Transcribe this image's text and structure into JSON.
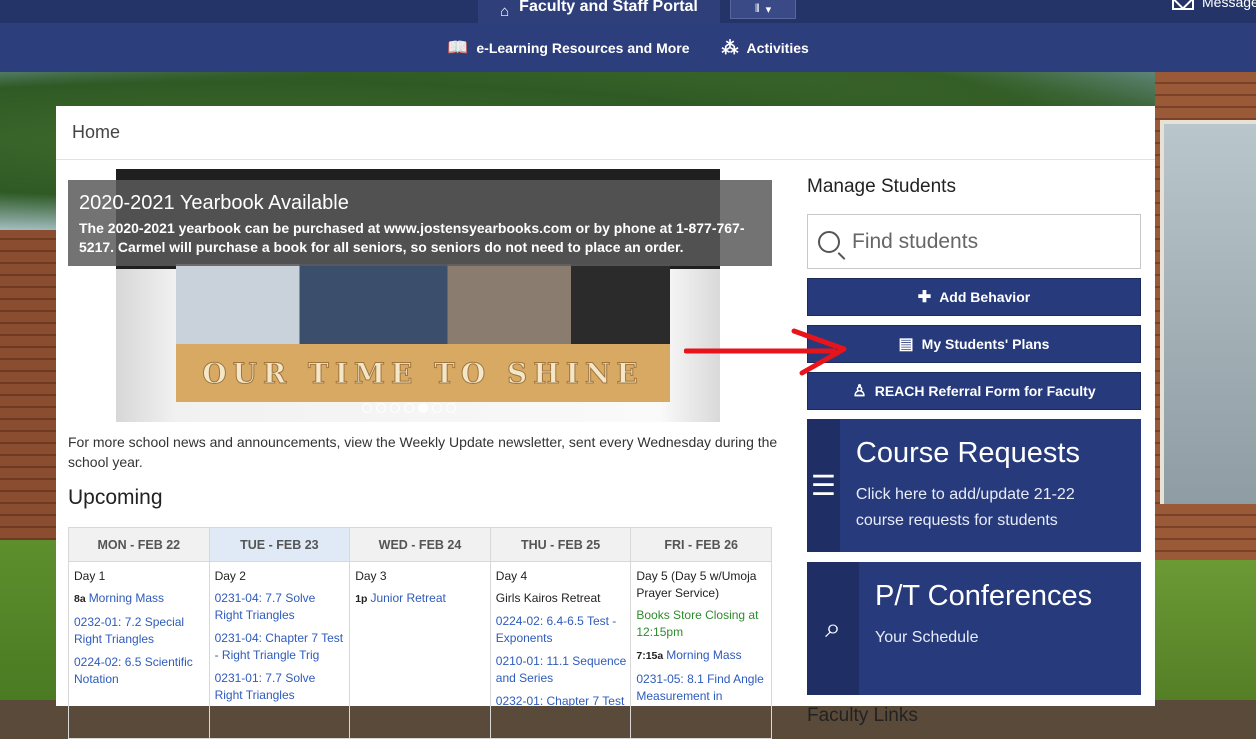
{
  "topbar": {
    "portal_label": "Faculty and Staff Portal",
    "messages_label": "Messages"
  },
  "nav": {
    "items": [
      {
        "label": "e-Learning Resources and More",
        "icon": "book-icon"
      },
      {
        "label": "Activities",
        "icon": "activities-icon"
      }
    ]
  },
  "breadcrumb": "Home",
  "carousel": {
    "title": "2020-2021 Yearbook Available",
    "body": "The 2020-2021 yearbook can be purchased at www.jostensyearbooks.com or by phone at 1-877-767-5217. Carmel will purchase a book for all seniors, so seniors do not need to place an order.",
    "banner_text": "OUR TIME TO SHINE",
    "slide_count": 7,
    "active_slide": 5
  },
  "news_text": "For more school news and announcements, view the Weekly Update newsletter, sent every Wednesday during the school year.",
  "upcoming": {
    "title": "Upcoming",
    "days": [
      {
        "header": "MON - FEB 22",
        "day": "Day 1",
        "events": [
          {
            "time": "8a",
            "text": "Morning Mass"
          },
          {
            "time": "",
            "text": "0232-01: 7.2 Special Right Triangles"
          },
          {
            "time": "",
            "text": "0224-02: 6.5 Scientific Notation"
          }
        ]
      },
      {
        "header": "TUE - FEB 23",
        "day": "Day 2",
        "events": [
          {
            "time": "",
            "text": "0231-04: 7.7 Solve Right Triangles"
          },
          {
            "time": "",
            "text": "0231-04: Chapter 7 Test - Right Triangle Trig"
          },
          {
            "time": "",
            "text": "0231-01: 7.7 Solve Right Triangles"
          }
        ]
      },
      {
        "header": "WED - FEB 24",
        "day": "Day 3",
        "events": [
          {
            "time": "1p",
            "text": "Junior Retreat"
          }
        ]
      },
      {
        "header": "THU - FEB 25",
        "day": "Day 4",
        "plain": "Girls Kairos Retreat",
        "events": [
          {
            "time": "",
            "text": "0224-02: 6.4-6.5 Test - Exponents"
          },
          {
            "time": "",
            "text": "0210-01: 11.1 Sequence and Series"
          },
          {
            "time": "",
            "text": "0232-01: Chapter 7 Test"
          }
        ]
      },
      {
        "header": "FRI - FEB 26",
        "day": "Day 5 (Day 5 w/Umoja Prayer Service)",
        "green": "Books Store Closing at 12:15pm",
        "events": [
          {
            "time": "7:15a",
            "text": "Morning Mass"
          },
          {
            "time": "",
            "text": "0231-05: 8.1 Find Angle Measurement in"
          }
        ]
      }
    ]
  },
  "manage": {
    "title": "Manage Students",
    "search_placeholder": "Find students",
    "buttons": [
      {
        "label": "Add Behavior",
        "icon": "plus-icon"
      },
      {
        "label": "My Students' Plans",
        "icon": "plans-icon"
      },
      {
        "label": "REACH Referral Form for Faculty",
        "icon": "person-icon"
      }
    ]
  },
  "tiles": [
    {
      "title": "Course Requests",
      "text": "Click here to add/update 21-22 course requests for students",
      "icon": "checklist-icon"
    },
    {
      "title": "P/T Conferences",
      "text": "Your Schedule",
      "icon": "search-list-icon"
    }
  ],
  "faculty_links_title": "Faculty Links",
  "colors": {
    "navy": "#253468",
    "button": "#273a7c",
    "link": "#2e5bbd",
    "green_link": "#2e8b2e",
    "annotation_arrow": "#e8141c"
  }
}
